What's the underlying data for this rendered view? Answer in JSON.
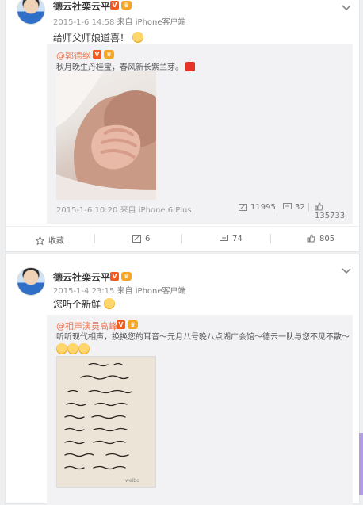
{
  "card1": {
    "username": "德云社栾云平",
    "meta_time": "2015-1-6 14:58",
    "meta_source": "来自 iPhone客户端",
    "text": "给师父师娘道喜！",
    "quote": {
      "username": "@郭德纲",
      "text": "秋月晚生丹桂宝，春风新长紫兰芽。",
      "time": "2015-1-6 10:20",
      "source": "来自 iPhone 6 Plus",
      "reposts": "11995",
      "comments": "32",
      "likes": "135733"
    },
    "actions": {
      "favorite": "收藏",
      "repost": "6",
      "comment": "74",
      "like": "805"
    }
  },
  "card2": {
    "username": "德云社栾云平",
    "meta_time": "2015-1-4 23:15",
    "meta_source": "来自 iPhone客户端",
    "text": "您听个新鲜",
    "quote": {
      "username": "@相声演员高峰",
      "text": "听听现代相声，换换您的耳音～元月八号晚八点湖广会馆～德云一队与您不见不散～"
    }
  },
  "colors": {
    "accent_orange": "#eb7350",
    "v_badge": "#f25a1f",
    "crown_badge": "#f6a623",
    "quote_bg": "#f2f2f5"
  }
}
